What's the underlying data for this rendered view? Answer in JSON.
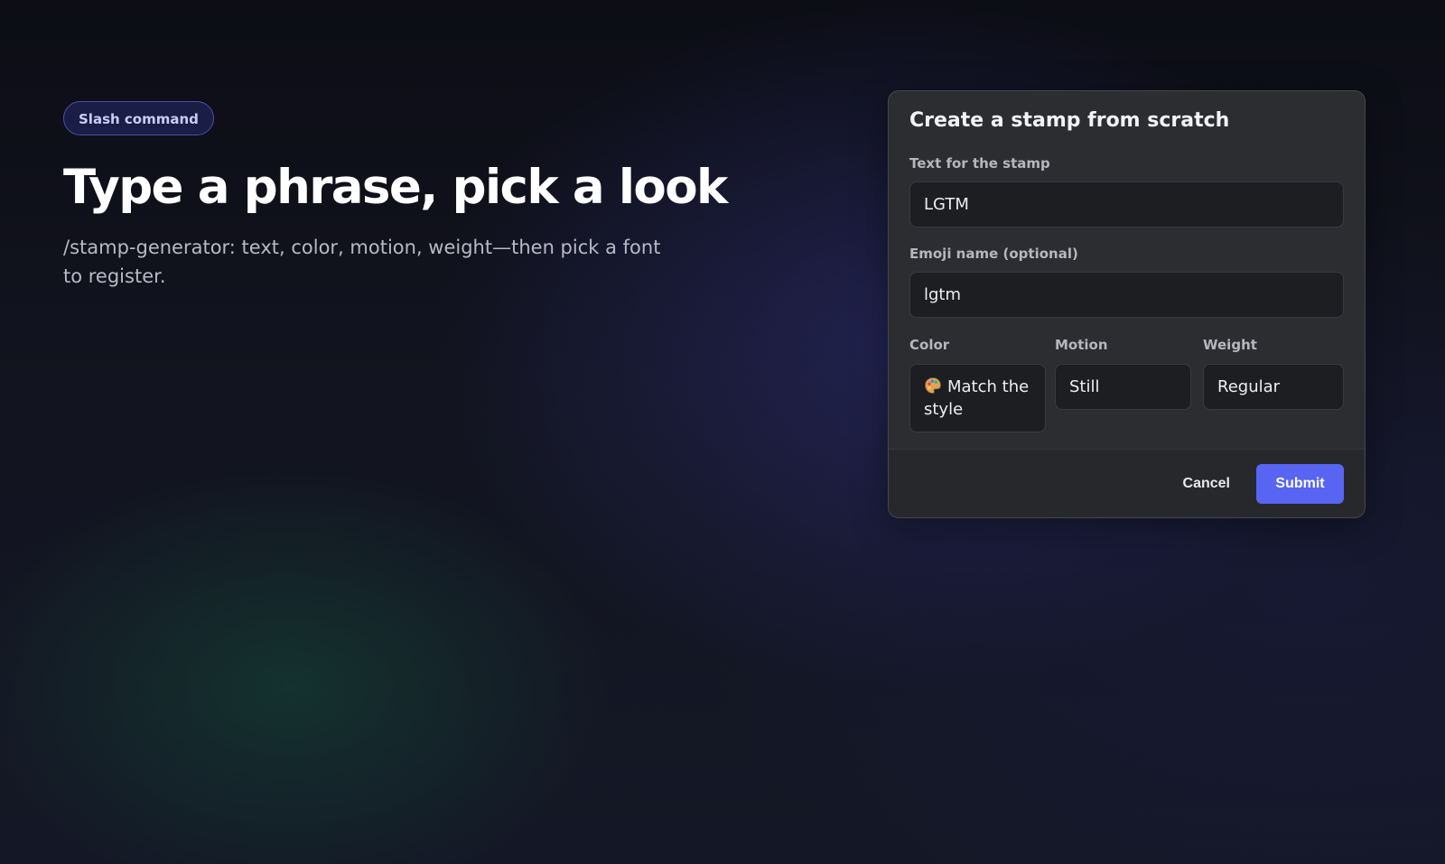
{
  "hero": {
    "badge": "Slash command",
    "title": "Type a phrase, pick a look",
    "subtitle": "/stamp-generator: text, color, motion, weight—then pick a font to register."
  },
  "dialog": {
    "title": "Create a stamp from scratch",
    "fields": {
      "text": {
        "label": "Text for the stamp",
        "value": "LGTM"
      },
      "emoji": {
        "label": "Emoji name (optional)",
        "value": "lgtm"
      },
      "color": {
        "label": "Color",
        "value": "Match the style",
        "icon": "palette-icon"
      },
      "motion": {
        "label": "Motion",
        "value": "Still"
      },
      "weight": {
        "label": "Weight",
        "value": "Regular"
      }
    },
    "buttons": {
      "cancel": "Cancel",
      "submit": "Submit"
    },
    "colors": {
      "accent": "#5865f2",
      "panel": "#2c2d31",
      "input": "#1d1e22"
    }
  }
}
